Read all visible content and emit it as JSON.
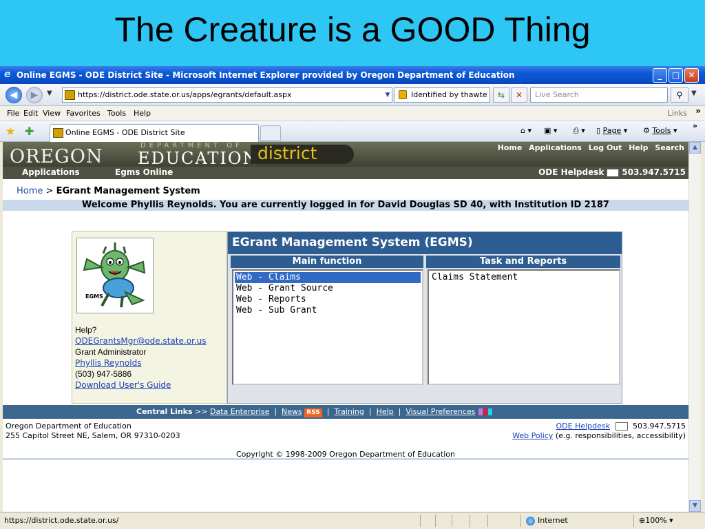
{
  "slide": {
    "title": "The Creature is a GOOD Thing"
  },
  "window": {
    "title": "Online EGMS - ODE District Site - Microsoft Internet Explorer provided by Oregon Department of Education",
    "controls": {
      "minimize": "_",
      "maximize": "□",
      "close": "✕"
    }
  },
  "addressbar": {
    "url": "https://district.ode.state.or.us/apps/egrants/default.aspx",
    "identity": "Identified by thawte",
    "search_placeholder": "Live Search"
  },
  "menubar": {
    "items": [
      "File",
      "Edit",
      "View",
      "Favorites",
      "Tools",
      "Help"
    ],
    "links": "Links",
    "more": "»"
  },
  "tabbar": {
    "tab_title": "Online EGMS - ODE District Site",
    "commands": {
      "page": "Page",
      "tools": "Tools"
    },
    "more": "»"
  },
  "site": {
    "logo": {
      "oregon": "OREGON",
      "department_of": "DEPARTMENT OF",
      "education": "EDUCATION",
      "district": "district"
    },
    "topnav": [
      "Home",
      "Applications",
      "Log Out",
      "Help",
      "Search"
    ],
    "subnav": {
      "applications": "Applications",
      "egms_online": "Egms Online",
      "helpdesk": "ODE Helpdesk",
      "phone": "503.947.5715"
    },
    "breadcrumb": {
      "home": "Home",
      "sep": ">",
      "current": "EGrant Management System"
    },
    "welcome": "Welcome Phyllis Reynolds. You are currently logged in for David Douglas SD 40, with Institution ID 2187"
  },
  "left_card": {
    "mascot_label": "EGMS",
    "help": "Help?",
    "email": "ODEGrantsMgr@ode.state.or.us",
    "role": "Grant Administrator",
    "name": "Phyllis Reynolds",
    "phone": "(503) 947-5886",
    "guide": "Download User's Guide"
  },
  "egms": {
    "title": "EGrant Management System (EGMS)",
    "main_function_header": "Main function",
    "task_header": "Task and Reports",
    "main_functions": [
      "Web - Claims",
      "Web - Grant Source",
      "Web - Reports",
      "Web - Sub Grant"
    ],
    "selected_index": 0,
    "tasks": [
      "Claims Statement"
    ]
  },
  "central_links": {
    "label": "Central Links",
    "arrows": ">>",
    "links": [
      "Data Enterprise",
      "News",
      "Training",
      "Help",
      "Visual Preferences"
    ],
    "rss": "RSS",
    "swatch_colors": [
      "#c27bd9",
      "#e21a3a",
      "#1ad2f0"
    ]
  },
  "footer": {
    "org": "Oregon Department of Education",
    "address": "255 Capitol Street NE, Salem, OR 97310-0203",
    "helpdesk": "ODE Helpdesk",
    "phone": "503.947.5715",
    "web_policy": "Web Policy",
    "policy_note": "(e.g. responsibilities, accessibility)",
    "copyright": "Copyright © 1998-2009 Oregon Department of Education"
  },
  "statusbar": {
    "url": "https://district.ode.state.or.us/",
    "zone": "Internet",
    "zoom": "100%"
  }
}
